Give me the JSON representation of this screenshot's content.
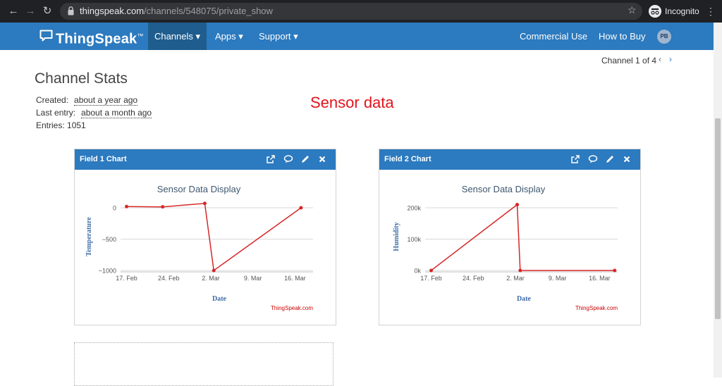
{
  "browser": {
    "url_host": "thingspeak.com",
    "url_path": "/channels/548075/private_show",
    "mode_label": "Incognito"
  },
  "navbar": {
    "logo": "ThingSpeak",
    "logo_tm": "™",
    "items": [
      "Channels ▾",
      "Apps ▾",
      "Support ▾"
    ],
    "right_items": [
      "Commercial Use",
      "How to Buy"
    ],
    "avatar": "PB"
  },
  "channel_nav": {
    "label": "Channel 1 of 4",
    "prev": "‹",
    "next": "›"
  },
  "stats": {
    "title": "Channel Stats",
    "created_label": "Created:",
    "created_value": "about a year ago",
    "last_label": "Last entry:",
    "last_value": "about a month ago",
    "entries_label": "Entries:",
    "entries_value": "1051"
  },
  "headline": "Sensor data",
  "panels": [
    {
      "title": "Field 1 Chart",
      "icons": [
        "external-link-icon",
        "comment-icon",
        "pencil-icon",
        "close-icon"
      ]
    },
    {
      "title": "Field 2 Chart",
      "icons": [
        "external-link-icon",
        "comment-icon",
        "pencil-icon",
        "close-icon"
      ]
    }
  ],
  "colors": {
    "navbar": "#2c7abf",
    "accent_red": "#e2141c",
    "series": "#d62728"
  },
  "chart_data": [
    {
      "type": "line",
      "title": "Sensor Data Display",
      "xlabel": "Date",
      "ylabel": "Temperature",
      "credit": "ThingSpeak.com",
      "x_ticks": [
        "17. Feb",
        "24. Feb",
        "2. Mar",
        "9. Mar",
        "16. Mar"
      ],
      "x_tick_days": [
        0,
        7,
        14,
        21,
        28
      ],
      "y_ticks": [
        0,
        -500,
        -1000
      ],
      "y_tick_labels": [
        "0",
        "−500",
        "−1000"
      ],
      "ylim": [
        -1000,
        0
      ],
      "xlim_days": [
        -1,
        31
      ],
      "series": [
        {
          "points": [
            [
              0,
              20
            ],
            [
              6,
              15
            ],
            [
              13,
              70
            ],
            [
              14.5,
              -1000
            ],
            [
              29,
              0
            ]
          ]
        }
      ]
    },
    {
      "type": "line",
      "title": "Sensor Data Display",
      "xlabel": "Date",
      "ylabel": "Humidity",
      "credit": "ThingSpeak.com",
      "x_ticks": [
        "17. Feb",
        "24. Feb",
        "2. Mar",
        "9. Mar",
        "16. Mar"
      ],
      "x_tick_days": [
        0,
        7,
        14,
        21,
        28
      ],
      "y_ticks": [
        0,
        100000,
        200000
      ],
      "y_tick_labels": [
        "0k",
        "100k",
        "200k"
      ],
      "ylim": [
        0,
        200000
      ],
      "xlim_days": [
        -1,
        31
      ],
      "series": [
        {
          "points": [
            [
              0,
              0
            ],
            [
              14.3,
              210000
            ],
            [
              14.8,
              0
            ],
            [
              30.5,
              0
            ]
          ]
        }
      ]
    }
  ]
}
